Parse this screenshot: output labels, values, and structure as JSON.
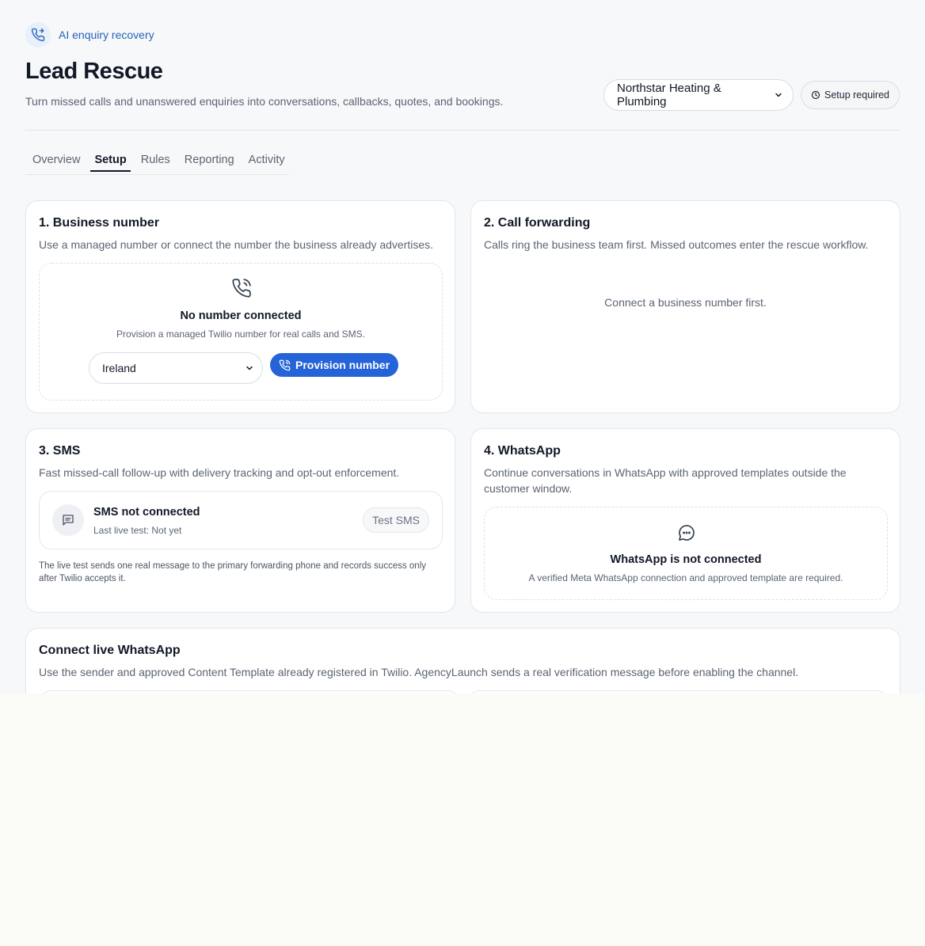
{
  "header": {
    "eyebrow": "AI enquiry recovery",
    "title": "Lead Rescue",
    "subtitle": "Turn missed calls and unanswered enquiries into conversations, callbacks, quotes, and bookings.",
    "business_select": "Northstar Heating & Plumbing",
    "status_badge": "Setup required"
  },
  "tabs": [
    {
      "label": "Overview",
      "active": false
    },
    {
      "label": "Setup",
      "active": true
    },
    {
      "label": "Rules",
      "active": false
    },
    {
      "label": "Reporting",
      "active": false
    },
    {
      "label": "Activity",
      "active": false
    }
  ],
  "business_number": {
    "title": "1. Business number",
    "description": "Use a managed number or connect the number the business already advertises.",
    "empty_title": "No number connected",
    "empty_desc": "Provision a managed Twilio number for real calls and SMS.",
    "country": "Ireland",
    "button": "Provision number"
  },
  "call_forwarding": {
    "title": "2. Call forwarding",
    "description": "Calls ring the business team first. Missed outcomes enter the rescue workflow.",
    "note": "Connect a business number first."
  },
  "sms": {
    "title": "3. SMS",
    "description": "Fast missed-call follow-up with delivery tracking and opt-out enforcement.",
    "status_title": "SMS not connected",
    "status_sub": "Last live test: Not yet",
    "test_button": "Test SMS",
    "note": "The live test sends one real message to the primary forwarding phone and records success only after Twilio accepts it."
  },
  "whatsapp": {
    "title": "4. WhatsApp",
    "description": "Continue conversations in WhatsApp with approved templates outside the customer window.",
    "empty_title": "WhatsApp is not connected",
    "empty_desc": "A verified Meta WhatsApp connection and approved template are required."
  },
  "connect_whatsapp": {
    "title": "Connect live WhatsApp",
    "description": "Use the sender and approved Content Template already registered in Twilio. AgencyLaunch sends a real verification message before enabling the channel."
  },
  "colors": {
    "accent": "#2563d8",
    "eyebrow": "#2563b8"
  }
}
